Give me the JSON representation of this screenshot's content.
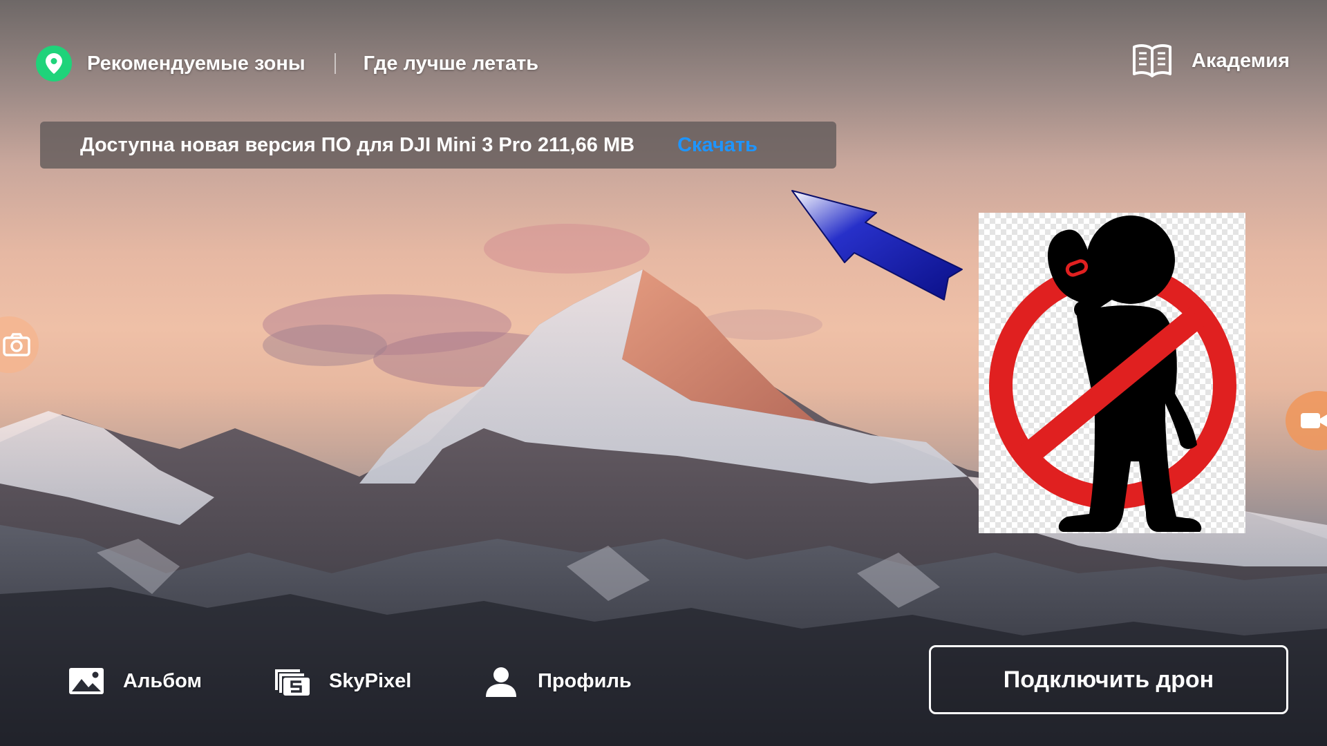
{
  "top_nav": {
    "recommended_zones": "Рекомендуемые зоны",
    "best_places": "Где лучше летать",
    "academy": "Академия",
    "icons": [
      "location-pin-icon",
      "book-icon"
    ]
  },
  "update_banner": {
    "message": "Доступна новая версия ПО для DJI Mini 3 Pro 211,66 MB",
    "download_label": "Скачать",
    "download_color": "#1e95ff"
  },
  "side_buttons": {
    "left_icon": "camera-icon",
    "right_icon": "video-camera-icon"
  },
  "overlay": {
    "arrow_icon": "blue-arrow-icon",
    "sticker_icon": "no-picking-nose-sign-icon",
    "sign_color": "#e02020"
  },
  "bottom_nav": {
    "album": "Альбом",
    "skypixel": "SkyPixel",
    "profile": "Профиль",
    "connect_drone": "Подключить дрон"
  },
  "colors": {
    "accent_green": "#1fd37a",
    "link_blue": "#1e95ff"
  }
}
